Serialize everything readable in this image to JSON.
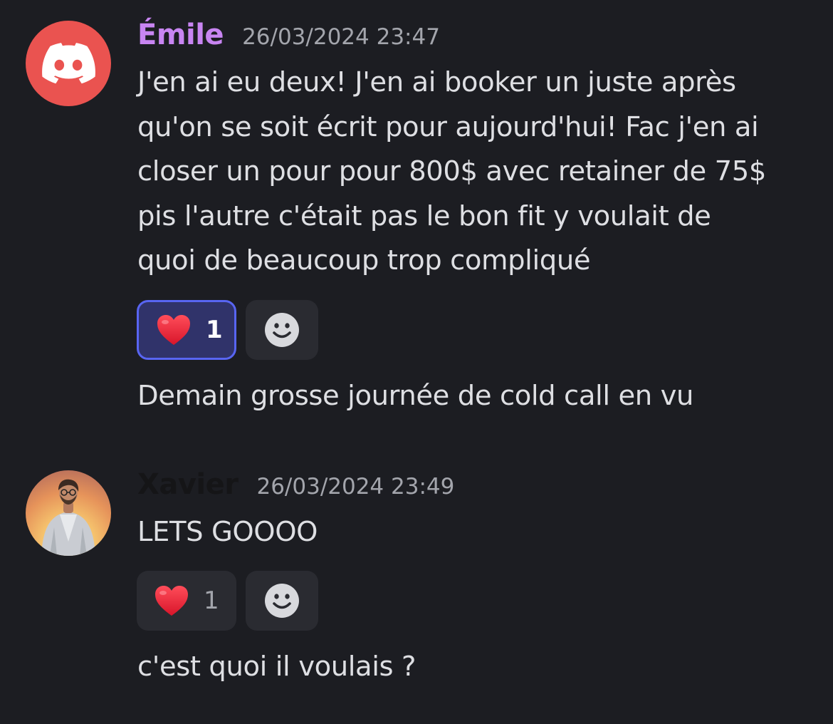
{
  "messages": [
    {
      "author": "Émile",
      "timestamp": "26/03/2024 23:47",
      "avatar_icon": "discord-logo-icon",
      "avatar_color": "#ea5350",
      "name_color": "#c885f2",
      "lines": [
        "J'en ai eu deux! J'en ai booker un juste après",
        "qu'on se soit écrit pour aujourd'hui! Fac j'en ai",
        "closer un pour pour 800$ avec retainer de 75$",
        "pis l'autre c'était pas le bon fit y voulait de",
        "quoi de beaucoup trop compliqué"
      ],
      "reaction": {
        "emoji": "heart-icon",
        "count": "1",
        "active": true
      },
      "followup": "Demain grosse journée de cold call en vu"
    },
    {
      "author": "Xavier",
      "timestamp": "26/03/2024 23:49",
      "avatar_icon": "user-photo-avatar",
      "name_color": "#151517",
      "lines": [
        "LETS GOOOO"
      ],
      "reaction": {
        "emoji": "heart-icon",
        "count": "1",
        "active": false
      },
      "followup": "c'est quoi il voulais ?"
    }
  ],
  "colors": {
    "background": "#1c1d22",
    "reaction_active_bg": "#30336a",
    "reaction_active_border": "#5865f2",
    "reaction_bg": "#2a2b31"
  }
}
